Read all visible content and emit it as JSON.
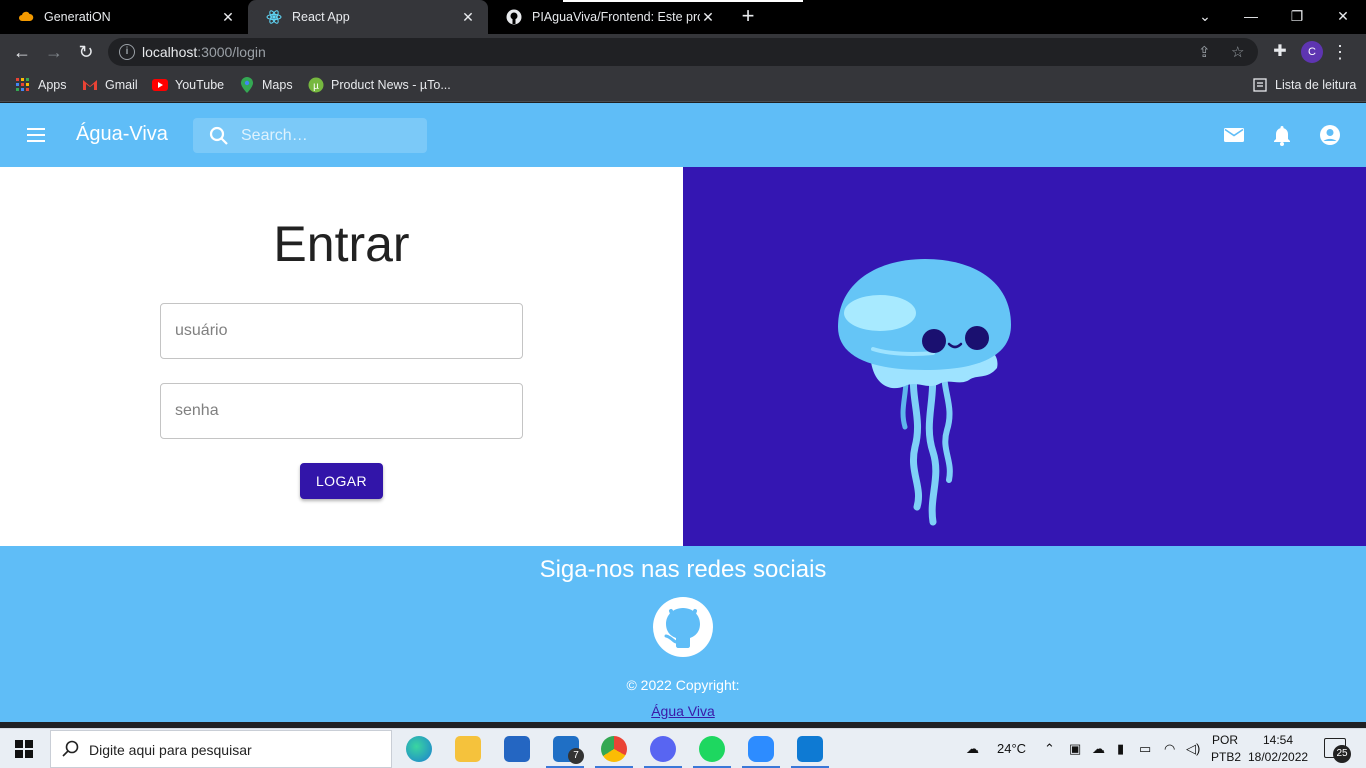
{
  "browser": {
    "tabs": [
      {
        "title": "GeneratiON",
        "active": false
      },
      {
        "title": "React App",
        "active": true
      },
      {
        "title": "PIAguaViva/Frontend: Este projeto",
        "active": false
      }
    ],
    "url_host": "localhost",
    "url_path": ":3000/login",
    "bookmarks": [
      "Apps",
      "Gmail",
      "YouTube",
      "Maps",
      "Product News - µTo..."
    ],
    "reading_list": "Lista de leitura",
    "profile_initial": "C"
  },
  "app": {
    "brand": "Água-Viva",
    "search_placeholder": "Search…",
    "login": {
      "title": "Entrar",
      "user_placeholder": "usuário",
      "password_placeholder": "senha",
      "button": "LOGAR"
    },
    "footer": {
      "title": "Siga-nos nas redes sociais",
      "copyright": "© 2022 Copyright:",
      "link": "Água Viva"
    },
    "colors": {
      "primary": "#5fbdf7",
      "hero_bg": "#3416b2",
      "button": "#3215a9"
    }
  },
  "taskbar": {
    "search_text": "Digite aqui para pesquisar",
    "weather": "24°C",
    "lang_top": "POR",
    "lang_bottom": "PTB2",
    "time": "14:54",
    "date": "18/02/2022",
    "notifications": "25",
    "mail_badge": "7"
  }
}
